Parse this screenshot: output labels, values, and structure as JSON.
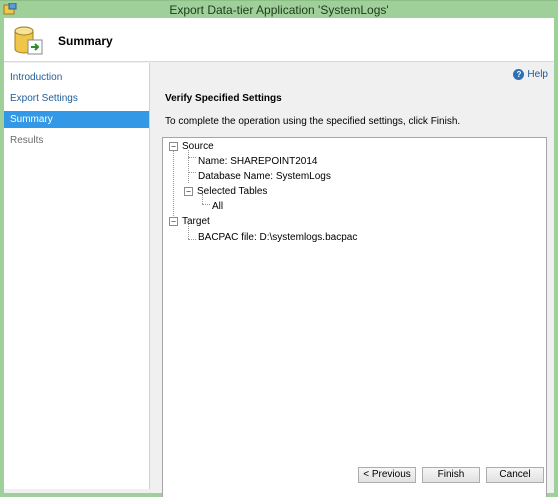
{
  "window": {
    "title": "Export Data-tier Application 'SystemLogs'"
  },
  "header": {
    "title": "Summary"
  },
  "sidebar": {
    "items": [
      {
        "label": "Introduction"
      },
      {
        "label": "Export Settings"
      },
      {
        "label": "Summary"
      },
      {
        "label": "Results"
      }
    ]
  },
  "main": {
    "help_label": "Help",
    "section_title": "Verify Specified Settings",
    "instruction": "To complete the operation using the specified settings, click Finish."
  },
  "tree": {
    "source_label": "Source",
    "name_item": "Name: SHAREPOINT2014",
    "database_item": "Database Name: SystemLogs",
    "selected_tables_label": "Selected Tables",
    "all_item": "All",
    "target_label": "Target",
    "bacpac_item": "BACPAC file: D:\\systemlogs.bacpac"
  },
  "footer": {
    "previous_label": "< Previous",
    "finish_label": "Finish",
    "cancel_label": "Cancel"
  },
  "colors": {
    "titlebar": "#9fd09a",
    "nav_active": "#3399e6",
    "link": "#1f5c99"
  }
}
